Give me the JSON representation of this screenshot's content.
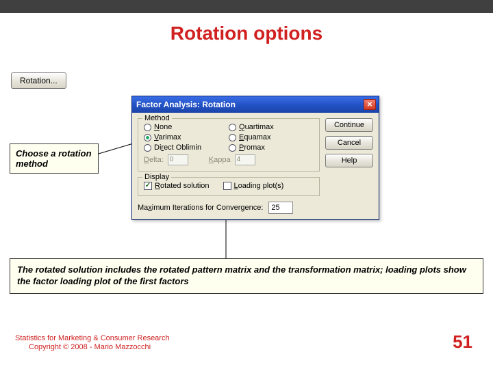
{
  "slide": {
    "title": "Rotation options",
    "page_number": "51",
    "credit_line1": "Statistics for Marketing & Consumer Research",
    "credit_line2": "Copyright © 2008 - Mario Mazzocchi"
  },
  "rotation_button": {
    "label": "Rotation..."
  },
  "dialog": {
    "title": "Factor Analysis: Rotation",
    "method_group": "Method",
    "methods": {
      "none_pre": "",
      "none_ul": "N",
      "none_rest": "one",
      "varimax_pre": "",
      "varimax_ul": "V",
      "varimax_rest": "arimax",
      "direct_pre": "Di",
      "direct_ul": "r",
      "direct_rest": "ect Oblimin",
      "quartimax_pre": "",
      "quartimax_ul": "Q",
      "quartimax_rest": "uartimax",
      "equamax_pre": "",
      "equamax_ul": "E",
      "equamax_rest": "quamax",
      "promax_pre": "",
      "promax_ul": "P",
      "promax_rest": "romax"
    },
    "delta_pre": "",
    "delta_ul": "D",
    "delta_rest": "elta:",
    "delta_value": "0",
    "kappa_pre": "",
    "kappa_ul": "K",
    "kappa_rest": "appa",
    "kappa_value": "4",
    "display_group": "Display",
    "rotated_pre": "",
    "rotated_ul": "R",
    "rotated_rest": "otated solution",
    "loading_pre": "",
    "loading_ul": "L",
    "loading_rest": "oading plot(s)",
    "maxiter_pre": "Ma",
    "maxiter_ul": "x",
    "maxiter_rest": "imum Iterations for Convergence:",
    "maxiter_value": "25",
    "buttons": {
      "continue": "Continue",
      "cancel": "Cancel",
      "help": "Help"
    }
  },
  "callouts": {
    "choose": "Choose a rotation method",
    "explain": "The rotated solution includes the rotated pattern matrix and the transformation matrix; loading plots show the factor loading plot of the first factors"
  }
}
